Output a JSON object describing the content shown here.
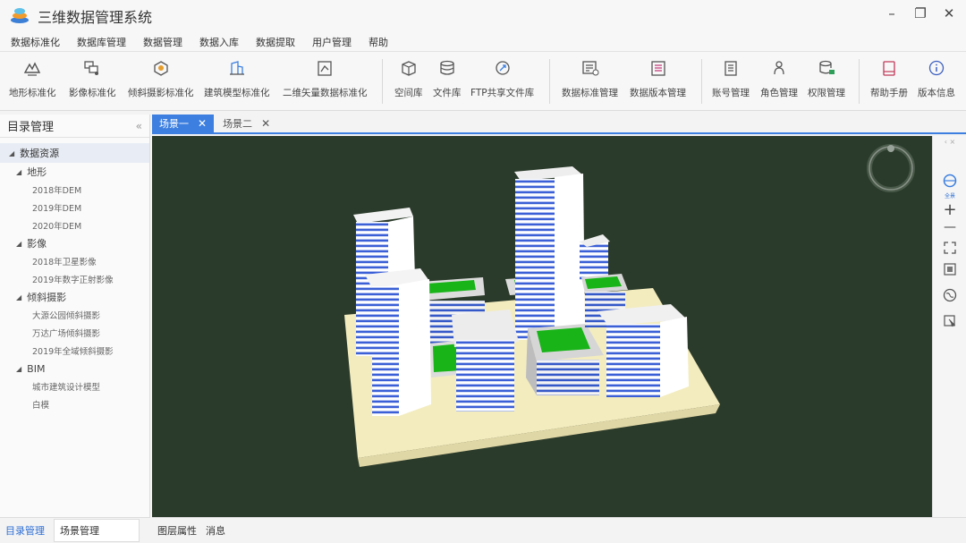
{
  "app": {
    "title": "三维数据管理系统"
  },
  "window_controls": {
    "minimize": "–",
    "restore": "❐",
    "close": "✕"
  },
  "menu": [
    "数据标准化",
    "数据库管理",
    "数据管理",
    "数据入库",
    "数据提取",
    "用户管理",
    "帮助"
  ],
  "toolbar": {
    "buttons": [
      {
        "label": "地形标准化",
        "icon": "terrain-icon"
      },
      {
        "label": "影像标准化",
        "icon": "imagery-icon"
      },
      {
        "label": "倾斜摄影标准化",
        "icon": "oblique-photo-icon"
      },
      {
        "label": "建筑模型标准化",
        "icon": "building-model-icon"
      },
      {
        "label": "二维矢量数据标准化",
        "icon": "vector-data-icon"
      },
      {
        "label": "空间库",
        "icon": "spatial-db-icon"
      },
      {
        "label": "文件库",
        "icon": "file-db-icon"
      },
      {
        "label": "FTP共享文件库",
        "icon": "ftp-icon"
      },
      {
        "label": "数据标准管理",
        "icon": "data-standard-icon"
      },
      {
        "label": "数据版本管理",
        "icon": "data-version-icon"
      },
      {
        "label": "账号管理",
        "icon": "account-icon"
      },
      {
        "label": "角色管理",
        "icon": "role-icon"
      },
      {
        "label": "权限管理",
        "icon": "permission-icon"
      },
      {
        "label": "帮助手册",
        "icon": "manual-icon"
      },
      {
        "label": "版本信息",
        "icon": "info-icon"
      }
    ]
  },
  "left_panel": {
    "title": "目录管理",
    "collapse": "«",
    "root": "数据资源",
    "categories": [
      {
        "label": "地形",
        "items": [
          "2018年DEM",
          "2019年DEM",
          "2020年DEM"
        ]
      },
      {
        "label": "影像",
        "items": [
          "2018年卫星影像",
          "2019年数字正射影像"
        ]
      },
      {
        "label": "倾斜摄影",
        "items": [
          "大源公园倾斜摄影",
          "万达广场倾斜摄影",
          "2019年全域倾斜摄影"
        ]
      },
      {
        "label": "BIM",
        "items": [
          "城市建筑设计模型",
          "白模"
        ]
      }
    ],
    "tabs": [
      "目录管理",
      "场景管理"
    ]
  },
  "scene_tabs": [
    {
      "label": "场景一",
      "close": "✕"
    },
    {
      "label": "场景二",
      "close": "✕"
    }
  ],
  "right_tools": {
    "globe_label": "全景",
    "zoom_in": "+",
    "zoom_out": "—"
  },
  "bottom_tabs": [
    "图层属性",
    "消息"
  ],
  "colors": {
    "accent": "#3c7fe0",
    "viewport_bg": "#2b3b2b",
    "base_pad": "#f3ecbf",
    "roof_green": "#18b418",
    "window_blue": "#3a5fd6"
  }
}
